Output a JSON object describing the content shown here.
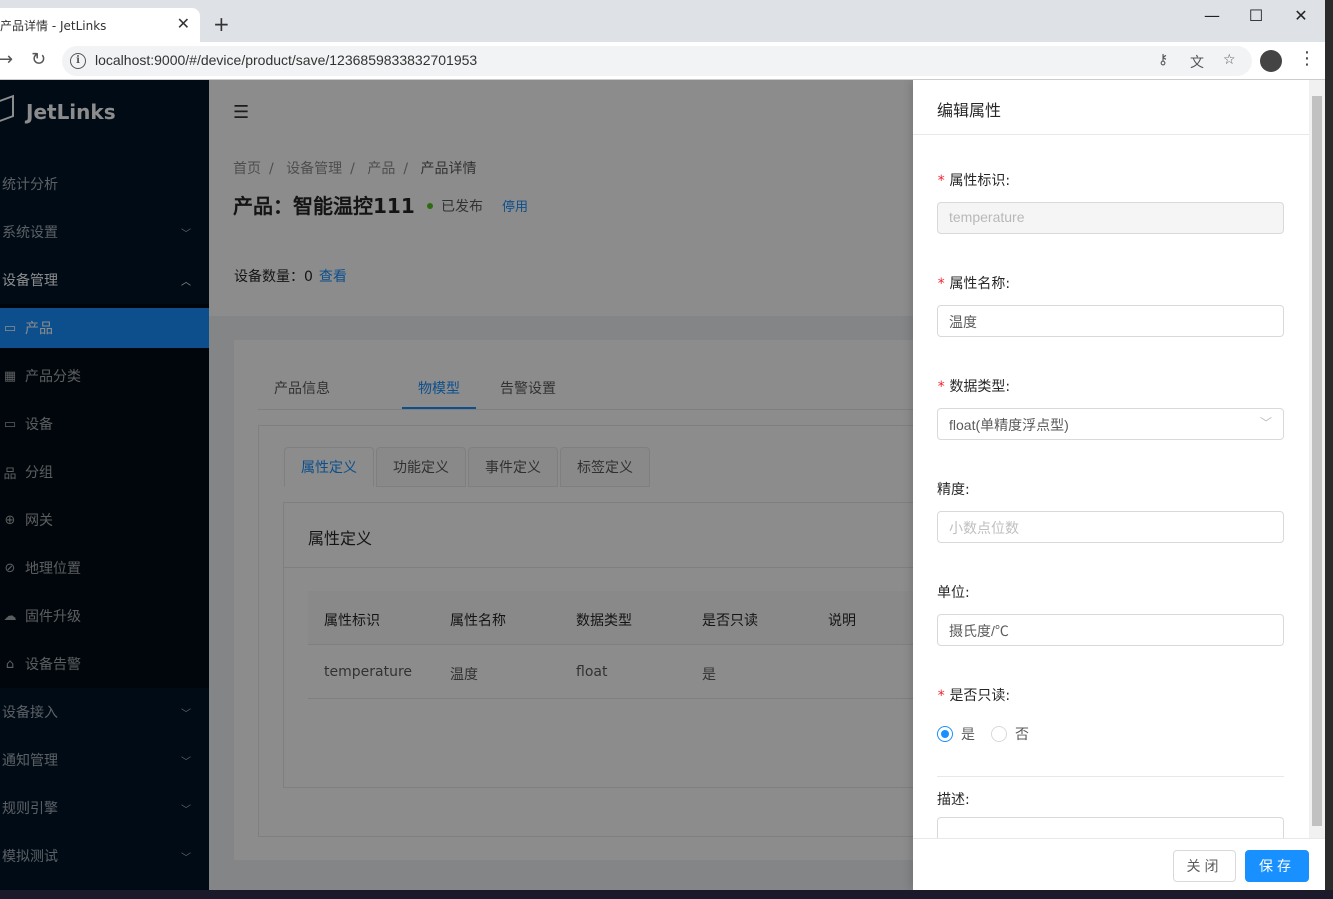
{
  "browser": {
    "tab_title": "产品详情 - JetLinks",
    "url": "localhost:9000/#/device/product/save/1236859833832701953"
  },
  "sidebar": {
    "logo": "JetLinks",
    "menu": [
      {
        "label": "统计分析",
        "has_children": false
      },
      {
        "label": "系统设置",
        "has_children": true
      },
      {
        "label": "设备管理",
        "has_children": true,
        "expanded": true
      }
    ],
    "submenu": [
      {
        "label": "产品",
        "icon": "laptop-icon",
        "active": true
      },
      {
        "label": "产品分类",
        "icon": "appstore-icon"
      },
      {
        "label": "设备",
        "icon": "desktop-icon"
      },
      {
        "label": "分组",
        "icon": "cluster-icon"
      },
      {
        "label": "网关",
        "icon": "global-icon"
      },
      {
        "label": "地理位置",
        "icon": "compass-icon"
      },
      {
        "label": "固件升级",
        "icon": "cloud-sync-icon"
      },
      {
        "label": "设备告警",
        "icon": "alert-icon"
      }
    ],
    "menu_bottom": [
      {
        "label": "设备接入"
      },
      {
        "label": "通知管理"
      },
      {
        "label": "规则引擎"
      },
      {
        "label": "模拟测试"
      }
    ]
  },
  "page": {
    "breadcrumb": [
      "首页",
      "设备管理",
      "产品",
      "产品详情"
    ],
    "title": "产品：智能温控111",
    "status": "已发布",
    "status_color": "#52c41a",
    "disable_link": "停用",
    "device_count_label": "设备数量：",
    "device_count": "0",
    "view_link": "查看"
  },
  "tabs": [
    "产品信息",
    "物模型",
    "告警设置"
  ],
  "model_tabs": [
    "属性定义",
    "功能定义",
    "事件定义",
    "标签定义"
  ],
  "properties": {
    "title": "属性定义",
    "columns": [
      "属性标识",
      "属性名称",
      "数据类型",
      "是否只读",
      "说明"
    ],
    "rows": [
      [
        "temperature",
        "温度",
        "float",
        "是",
        ""
      ]
    ]
  },
  "drawer": {
    "title": "编辑属性",
    "id_label": "属性标识:",
    "id_value": "temperature",
    "name_label": "属性名称:",
    "name_value": "温度",
    "type_label": "数据类型:",
    "type_value": "float(单精度浮点型)",
    "precision_label": "精度:",
    "precision_placeholder": "小数点位数",
    "unit_label": "单位:",
    "unit_value": "摄氏度/℃",
    "readonly_label": "是否只读:",
    "readonly_yes": "是",
    "readonly_no": "否",
    "desc_label": "描述:",
    "close_btn": "关闭",
    "save_btn": "保存"
  },
  "colors": {
    "primary": "#1890ff",
    "sidebar_bg": "#001529",
    "required": "#f5222d"
  }
}
